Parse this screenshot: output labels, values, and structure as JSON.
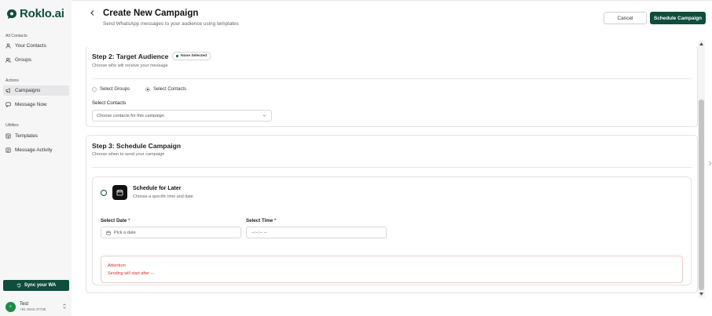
{
  "brand": {
    "name": "Roklo.ai",
    "color": "#0f4d3c"
  },
  "sidebar": {
    "sections": [
      {
        "label": "All Contacts",
        "items": [
          {
            "label": "Your Contacts",
            "icon": "user-icon"
          },
          {
            "label": "Groups",
            "icon": "users-icon"
          }
        ]
      },
      {
        "label": "Actions",
        "items": [
          {
            "label": "Campaigns",
            "icon": "megaphone-icon",
            "active": true
          },
          {
            "label": "Message Now",
            "icon": "message-icon"
          }
        ]
      },
      {
        "label": "Utilities",
        "items": [
          {
            "label": "Templates",
            "icon": "template-icon"
          },
          {
            "label": "Message Activity",
            "icon": "list-icon"
          }
        ]
      }
    ],
    "sync_label": "Sync your WA",
    "user": {
      "name": "Test",
      "phone": "+91 9104 47725",
      "initial": "c"
    }
  },
  "header": {
    "title": "Create New Campaign",
    "subtitle": "Send WhatsApp messages to your audience using templates",
    "cancel_label": "Cancel",
    "schedule_label": "Schedule Campaign"
  },
  "step2": {
    "title": "Step 2: Target Audience",
    "badge": "None Selected",
    "subtitle": "Choose who will receive your message",
    "options": [
      {
        "label": "Select Groups",
        "selected": false
      },
      {
        "label": "Select Contacts",
        "selected": true
      }
    ],
    "field_label": "Select Contacts",
    "select_placeholder": "Choose contacts for this campaign"
  },
  "step3": {
    "title": "Step 3: Schedule Campaign",
    "subtitle": "Choose when to send your campaign",
    "option_title": "Schedule for Later",
    "option_subtitle": "Choose a specific time and date",
    "date_label": "Select Date",
    "date_placeholder": "Pick a date",
    "time_label": "Select Time",
    "time_placeholder": "--:--:-- --",
    "required_mark": "*",
    "attention_title": "Attention",
    "attention_text": "Sending will start after --."
  }
}
